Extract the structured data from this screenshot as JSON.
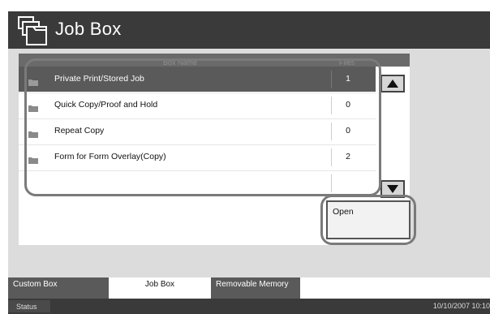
{
  "header": {
    "title": "Job Box",
    "icon": "job-box-icon"
  },
  "list": {
    "columns": {
      "name": "Box Name",
      "files": "Files"
    },
    "rows": [
      {
        "name": "Private Print/Stored Job",
        "files": "1",
        "selected": true
      },
      {
        "name": "Quick Copy/Proof and Hold",
        "files": "0",
        "selected": false
      },
      {
        "name": "Repeat Copy",
        "files": "0",
        "selected": false
      },
      {
        "name": "Form for Form Overlay(Copy)",
        "files": "2",
        "selected": false
      }
    ]
  },
  "buttons": {
    "open": "Open",
    "scroll_up": "scroll-up-icon",
    "scroll_down": "scroll-down-icon"
  },
  "tabs": [
    {
      "label": "Custom Box",
      "active": false
    },
    {
      "label": "Job Box",
      "active": true
    },
    {
      "label": "Removable Memory",
      "active": false
    }
  ],
  "status": {
    "label": "Status",
    "datetime": "10/10/2007   10:10"
  },
  "colors": {
    "titlebar": "#3a3a3a",
    "selected_row": "#5a5a5a",
    "panel_bg": "#dcdcdc"
  }
}
